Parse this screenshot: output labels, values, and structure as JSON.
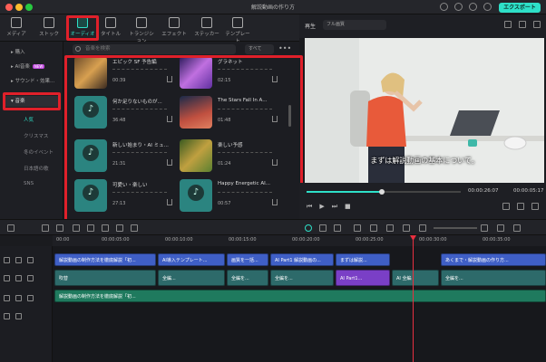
{
  "window": {
    "title": "解説動画の作り方",
    "export_label": "エクスポート"
  },
  "media_tabs": [
    {
      "label": "メディア"
    },
    {
      "label": "ストック"
    },
    {
      "label": "オーディオ"
    },
    {
      "label": "タイトル"
    },
    {
      "label": "トランジション"
    },
    {
      "label": "エフェクト"
    },
    {
      "label": "ステッカー"
    },
    {
      "label": "テンプレート"
    }
  ],
  "sidebar": {
    "items": [
      {
        "label": "▸ 購入"
      },
      {
        "label": "▸ AI音楽",
        "badge": "NEW"
      },
      {
        "label": "▸ サウンド・効果..."
      },
      {
        "label": "▾ 音楽"
      }
    ],
    "sub_items": [
      "人気",
      "クリスマス",
      "冬のイベント",
      "日本語の歌",
      "SNS"
    ]
  },
  "library": {
    "search_placeholder": "音楽を検索",
    "filter_label": "すべて",
    "more": "•••",
    "tracks": [
      {
        "title": "エピック SF 予告編",
        "duration": "00:39"
      },
      {
        "title": "グラネット",
        "duration": "02:15"
      },
      {
        "title": "何か足りないものが...",
        "duration": "36:48"
      },
      {
        "title": "The Stars Fall In A...",
        "duration": "01:48"
      },
      {
        "title": "新しい始まり・AI ミュ...",
        "duration": "21:31"
      },
      {
        "title": "楽しい予感",
        "duration": "01:24"
      },
      {
        "title": "可愛い・楽しい",
        "duration": "27:13"
      },
      {
        "title": "Happy Energetic AI...",
        "duration": "00:57"
      }
    ]
  },
  "preview": {
    "play_label": "再生",
    "quality": "フル画質",
    "subtitle": "まずは解説動画の基本について。",
    "current_time": "00:00:26:07",
    "total_time": "00:00:05:17"
  },
  "timeline": {
    "ticks": [
      "00:00",
      "00:00:05:00",
      "00:00:10:00",
      "00:00:15:00",
      "00:00:20:00",
      "00:00:25:00",
      "00:00:30:00",
      "00:00:35:00"
    ],
    "text_clips": [
      "解説動画の制作方法を徹底解説「初...",
      "AI導入テンプレート...",
      "画質を一括...",
      "AI Part1 解説動画の...",
      "まずは解説...",
      "あくまで・解説動画の作り方..."
    ],
    "video_clips": [
      "吹替",
      "全編...",
      "全編を...",
      "全編を...",
      "AI Part1...",
      "AI 全編",
      "全編を..."
    ],
    "audio_clip": "解説動画の制作方法を徹底解説「初..."
  },
  "colors": {
    "accent": "#2ee0c8",
    "highlight": "#e0202a",
    "playhead": "#e83040"
  }
}
